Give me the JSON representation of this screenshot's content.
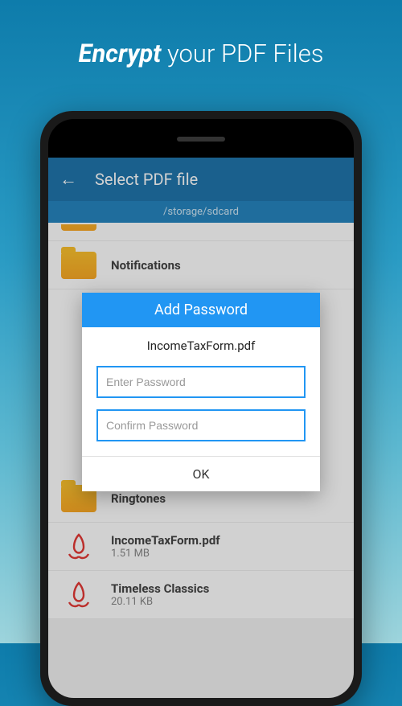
{
  "headline": {
    "bold": "Encrypt",
    "rest": " your PDF Files"
  },
  "appbar": {
    "title": "Select PDF file"
  },
  "pathbar": {
    "path": "/storage/sdcard"
  },
  "list": {
    "items": [
      {
        "type": "folder",
        "name": "Notifications",
        "size": ""
      },
      {
        "type": "folder",
        "name": "Ringtones",
        "size": ""
      },
      {
        "type": "pdf",
        "name": "IncomeTaxForm.pdf",
        "size": "1.51 MB"
      },
      {
        "type": "pdf",
        "name": "Timeless Classics",
        "size": "20.11 KB"
      }
    ]
  },
  "dialog": {
    "title": "Add Password",
    "filename": "IncomeTaxForm.pdf",
    "password_placeholder": "Enter Password",
    "confirm_placeholder": "Confirm Password",
    "ok_label": "OK"
  }
}
